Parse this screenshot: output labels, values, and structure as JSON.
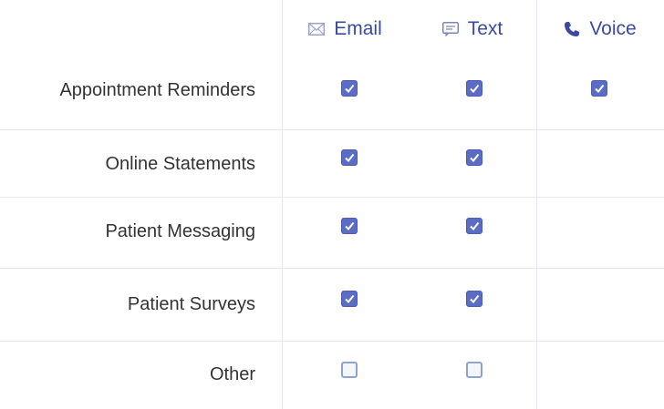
{
  "columns": [
    {
      "key": "email",
      "label": "Email",
      "icon": "envelope-icon"
    },
    {
      "key": "text",
      "label": "Text",
      "icon": "message-icon"
    },
    {
      "key": "voice",
      "label": "Voice",
      "icon": "phone-icon"
    }
  ],
  "rows": [
    {
      "label": "Appointment Reminders",
      "email": true,
      "text": true,
      "voice": true
    },
    {
      "label": "Online Statements",
      "email": true,
      "text": true,
      "voice": null
    },
    {
      "label": "Patient Messaging",
      "email": true,
      "text": true,
      "voice": null
    },
    {
      "label": "Patient Surveys",
      "email": true,
      "text": true,
      "voice": null
    },
    {
      "label": "Other",
      "email": false,
      "text": false,
      "voice": null
    }
  ],
  "colors": {
    "accent": "#3a4a9e",
    "checkbox_checked": "#5a6cc4",
    "checkbox_unchecked_border": "#8fa4c8",
    "divider": "#e6e8ee"
  }
}
